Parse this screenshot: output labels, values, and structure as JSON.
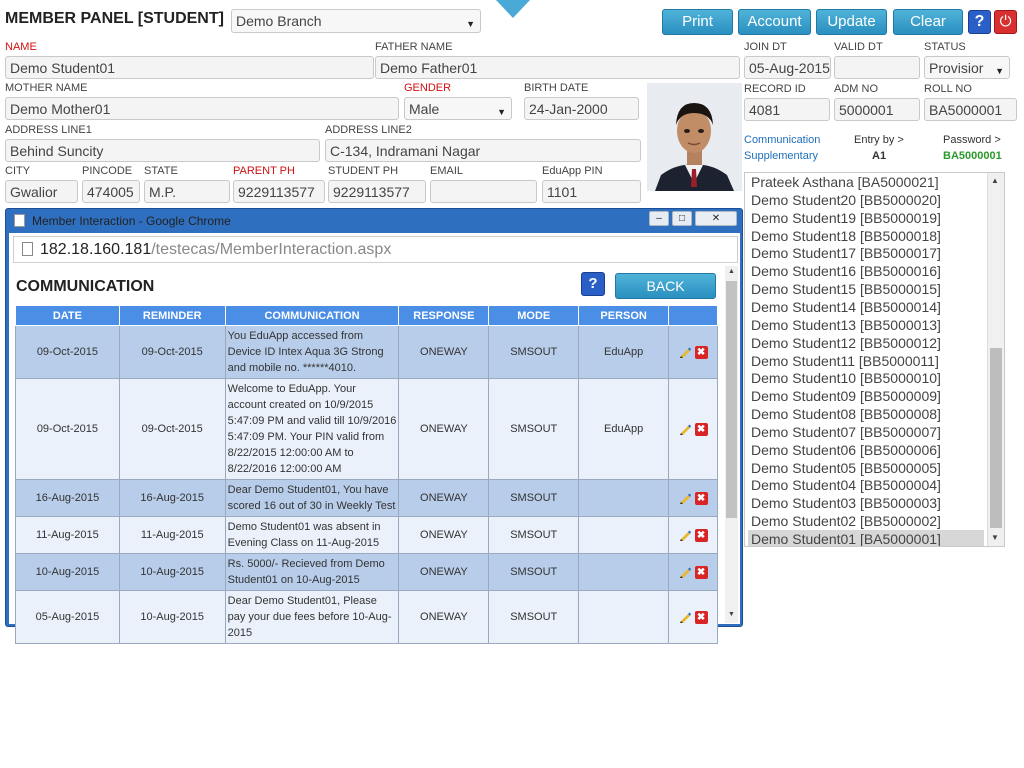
{
  "header": {
    "title": "MEMBER PANEL [STUDENT]",
    "branch": "Demo Branch",
    "buttons": {
      "print": "Print",
      "account": "Account",
      "update": "Update",
      "clear": "Clear"
    },
    "help_glyph": "?",
    "power_glyph": "⏻"
  },
  "form": {
    "name": {
      "label": "NAME",
      "value": "Demo Student01"
    },
    "father": {
      "label": "FATHER NAME",
      "value": "Demo Father01"
    },
    "join": {
      "label": "JOIN DT",
      "value": "05-Aug-2015"
    },
    "valid": {
      "label": "VALID DT",
      "value": ""
    },
    "status": {
      "label": "STATUS",
      "value": "Provisior"
    },
    "mother": {
      "label": "MOTHER NAME",
      "value": "Demo Mother01"
    },
    "gender": {
      "label": "GENDER",
      "value": "Male"
    },
    "birth": {
      "label": "BIRTH DATE",
      "value": "24-Jan-2000"
    },
    "record": {
      "label": "RECORD ID",
      "value": "4081"
    },
    "adm": {
      "label": "ADM NO",
      "value": "5000001"
    },
    "roll": {
      "label": "ROLL NO",
      "value": "BA5000001"
    },
    "addr1": {
      "label": "ADDRESS LINE1",
      "value": "Behind Suncity"
    },
    "addr2": {
      "label": "ADDRESS LINE2",
      "value": "C-134, Indramani Nagar"
    },
    "city": {
      "label": "CITY",
      "value": "Gwalior"
    },
    "pincode": {
      "label": "PINCODE",
      "value": "474005"
    },
    "state": {
      "label": "STATE",
      "value": "M.P."
    },
    "parent_ph": {
      "label": "PARENT PH",
      "value": "9229113577"
    },
    "student_ph": {
      "label": "STUDENT PH",
      "value": "9229113577"
    },
    "email": {
      "label": "EMAIL",
      "value": ""
    },
    "eduapp_pin": {
      "label": "EduApp PIN",
      "value": "1101"
    }
  },
  "links": {
    "communication": "Communication",
    "supplementary": "Supplementary",
    "entry_by_label": "Entry by >",
    "entry_by_value": "A1",
    "password_label": "Password >",
    "password_value": "BA5000001"
  },
  "member_list": [
    "Prateek Asthana [BA5000021]",
    "Demo Student20 [BB5000020]",
    "Demo Student19 [BB5000019]",
    "Demo Student18 [BB5000018]",
    "Demo Student17 [BB5000017]",
    "Demo Student16 [BB5000016]",
    "Demo Student15 [BB5000015]",
    "Demo Student14 [BB5000014]",
    "Demo Student13 [BB5000013]",
    "Demo Student12 [BB5000012]",
    "Demo Student11 [BB5000011]",
    "Demo Student10 [BB5000010]",
    "Demo Student09 [BB5000009]",
    "Demo Student08 [BB5000008]",
    "Demo Student07 [BB5000007]",
    "Demo Student06 [BB5000006]",
    "Demo Student05 [BB5000005]",
    "Demo Student04 [BB5000004]",
    "Demo Student03 [BB5000003]",
    "Demo Student02 [BB5000002]",
    "Demo Student01 [BA5000001]"
  ],
  "popup": {
    "window_title": "Member Interaction - Google Chrome",
    "url_host": "182.18.160.181",
    "url_path": "/testecas/MemberInteraction.aspx",
    "heading": "COMMUNICATION",
    "back": "BACK",
    "help_glyph": "?",
    "columns": [
      "DATE",
      "REMINDER",
      "COMMUNICATION",
      "RESPONSE",
      "MODE",
      "PERSON"
    ],
    "rows": [
      {
        "date": "09-Oct-2015",
        "reminder": "09-Oct-2015",
        "text": "You EduApp accessed from Device ID Intex Aqua 3G Strong and mobile no. ******4010.",
        "response": "ONEWAY",
        "mode": "SMSOUT",
        "person": "EduApp"
      },
      {
        "date": "09-Oct-2015",
        "reminder": "09-Oct-2015",
        "text": "Welcome to EduApp. Your account created on 10/9/2015 5:47:09 PM and valid till 10/9/2016 5:47:09 PM. Your PIN valid from 8/22/2015 12:00:00 AM to 8/22/2016 12:00:00 AM",
        "response": "ONEWAY",
        "mode": "SMSOUT",
        "person": "EduApp"
      },
      {
        "date": "16-Aug-2015",
        "reminder": "16-Aug-2015",
        "text": "Dear Demo Student01, You have scored 16 out of 30 in Weekly Test",
        "response": "ONEWAY",
        "mode": "SMSOUT",
        "person": ""
      },
      {
        "date": "11-Aug-2015",
        "reminder": "11-Aug-2015",
        "text": "Demo Student01 was absent in Evening Class on 11-Aug-2015",
        "response": "ONEWAY",
        "mode": "SMSOUT",
        "person": ""
      },
      {
        "date": "10-Aug-2015",
        "reminder": "10-Aug-2015",
        "text": "Rs. 5000/- Recieved from Demo Student01 on 10-Aug-2015",
        "response": "ONEWAY",
        "mode": "SMSOUT",
        "person": ""
      },
      {
        "date": "05-Aug-2015",
        "reminder": "10-Aug-2015",
        "text": "Dear Demo Student01, Please pay your due fees before 10-Aug-2015",
        "response": "ONEWAY",
        "mode": "SMSOUT",
        "person": ""
      }
    ]
  },
  "colors": {
    "accent": "#2b8fc0",
    "popup_frame": "#2f6fc0",
    "table_header": "#4a8ee6",
    "required_label": "#d01010",
    "password_green": "#2a9a2a"
  }
}
